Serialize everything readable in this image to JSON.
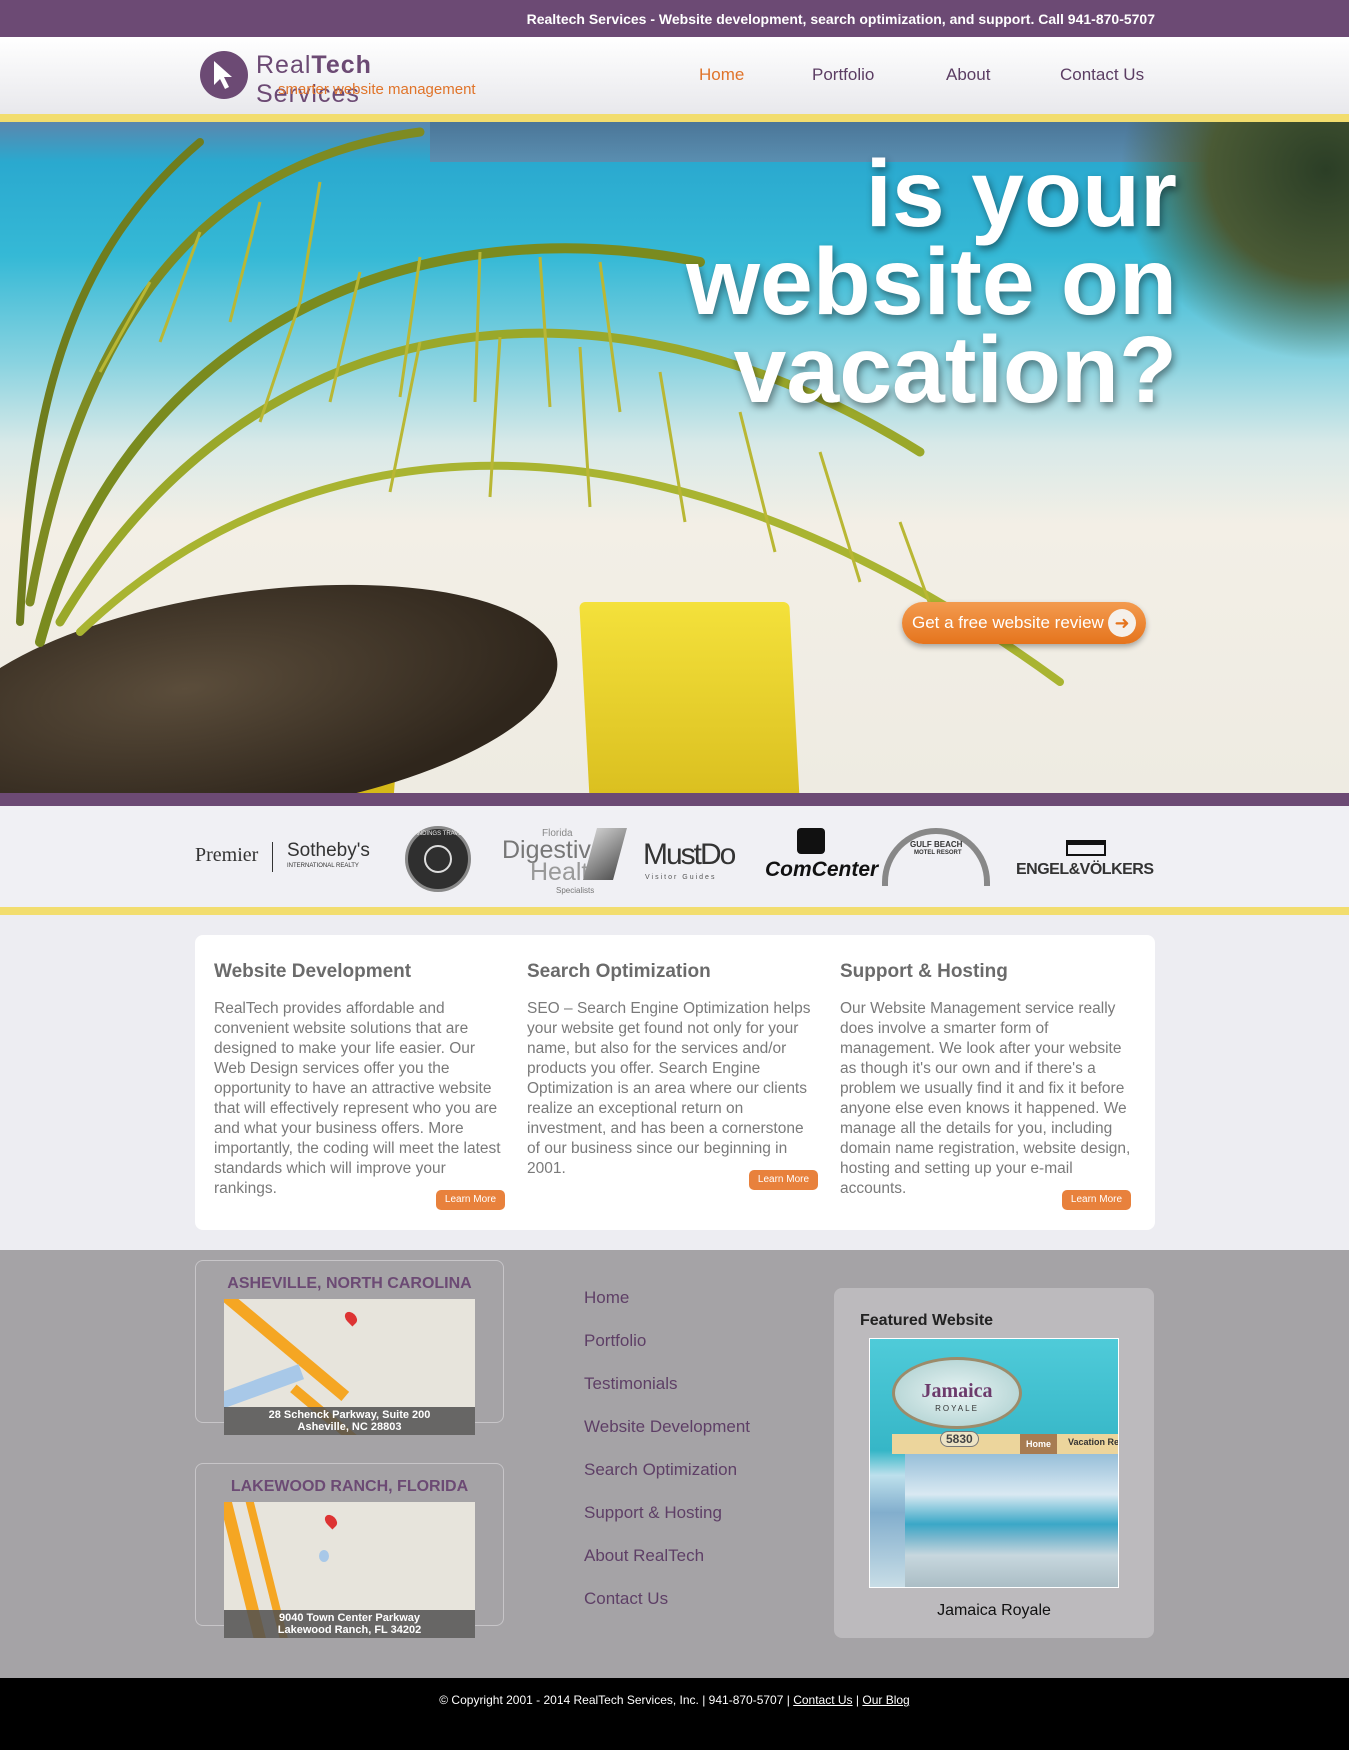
{
  "topbar": {
    "text": "Realtech Services - Website development, search optimization, and support. Call 941-870-5707"
  },
  "logo": {
    "name_light": "Real",
    "name_bold": "Tech",
    "name_rest": " Services",
    "tagline": "smarter website management"
  },
  "nav": {
    "items": [
      "Home",
      "Portfolio",
      "About",
      "Contact Us"
    ],
    "active": "Home"
  },
  "hero": {
    "headline_lines": [
      "is your",
      "website on",
      "vacation?"
    ],
    "cta_label": "Get a free website review"
  },
  "clients": {
    "logos": [
      {
        "label": "Premier",
        "label2": "Sotheby's",
        "label3": "INTERNATIONAL REALTY"
      },
      {
        "label": "LANDINGS TRAVEL"
      },
      {
        "label": "Florida",
        "label2": "Digestive",
        "label3": "Health",
        "label4": "Specialists"
      },
      {
        "label": "MustDo",
        "label2": "Visitor Guides"
      },
      {
        "label": "ComCenter"
      },
      {
        "label": "GULF BEACH",
        "label2": "MOTEL RESORT"
      },
      {
        "label": "ENGEL&VÖLKERS"
      }
    ]
  },
  "services": [
    {
      "title": "Website Development",
      "text": "RealTech provides affordable and convenient website solutions that are designed to make your life easier. Our Web Design services offer you the opportunity to have an attractive website that will effectively represent who you are and what your business offers. More importantly, the coding will meet the latest standards which will improve your rankings.",
      "button": "Learn More"
    },
    {
      "title": "Search Optimization",
      "text": "SEO – Search Engine Optimization helps your website get found not only for your name, but also for the services and/or products you offer. Search Engine Optimization is an area where our clients realize an exceptional return on investment, and has been a cornerstone of our business since our beginning in 2001.",
      "button": "Learn More"
    },
    {
      "title": "Support & Hosting",
      "text": "Our Website Management service really does involve a smarter form of management. We look after your website as though it's our own and if there's a problem we usually find it and fix it before anyone else even knows it happened. We manage all the details for you, including domain name registration, website design, hosting and setting up your e-mail accounts.",
      "button": "Learn More"
    }
  ],
  "offices": [
    {
      "title": "ASHEVILLE, NORTH CAROLINA",
      "addr1": "28 Schenck Parkway, Suite 200",
      "addr2": "Asheville, NC 28803"
    },
    {
      "title": "LAKEWOOD RANCH, FLORIDA",
      "addr1": "9040 Town Center Parkway",
      "addr2": "Lakewood Ranch, FL 34202"
    }
  ],
  "footer_links": [
    "Home",
    "Portfolio",
    "Testimonials",
    "Website Development",
    "Search Optimization",
    "Support & Hosting",
    "About RealTech",
    "Contact Us"
  ],
  "featured": {
    "title": "Featured Website",
    "caption": "Jamaica Royale",
    "shot_logo": "Jamaica",
    "shot_logo2": "ROYALE",
    "shot_num": "5830",
    "shot_nav": [
      "Home",
      "Vacation Re"
    ]
  },
  "copyright": {
    "text": "© Copyright 2001 - 2014 RealTech Services, Inc. | 941-870-5707 |",
    "link1": "Contact Us",
    "sep": "|",
    "link2": "Our Blog"
  },
  "colors": {
    "purple": "#6c4a74",
    "orange": "#e0742a",
    "yellow": "#f2dd6e"
  }
}
